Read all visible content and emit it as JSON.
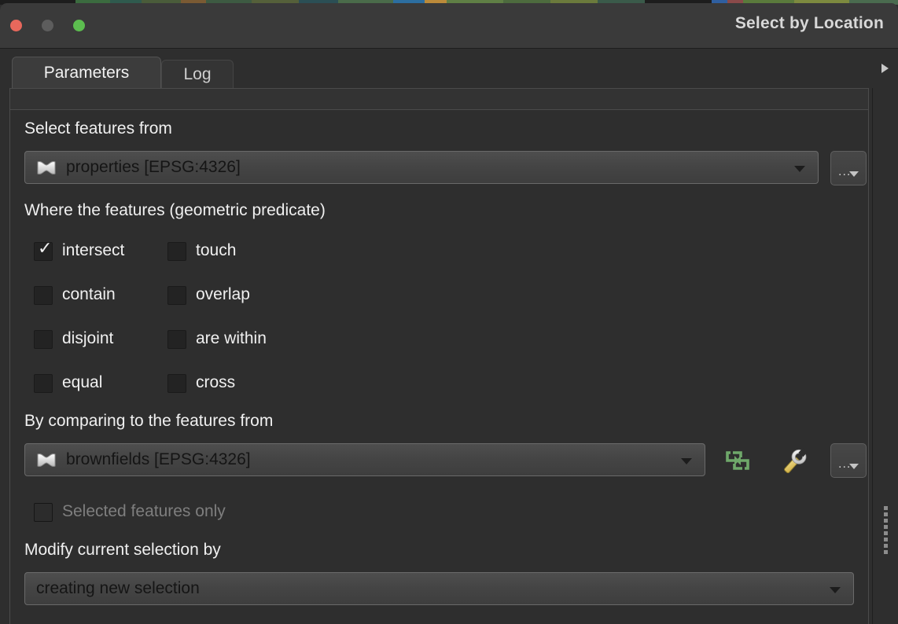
{
  "window": {
    "title": "Select by Location",
    "controls": {
      "close": "close-button",
      "minimize": "minimize-button",
      "maximize": "maximize-button"
    }
  },
  "tabs": [
    {
      "label": "Parameters",
      "active": true
    },
    {
      "label": "Log",
      "active": false
    }
  ],
  "expand_arrow_icon": "chevron-right-icon",
  "form": {
    "select_features_from": {
      "label": "Select features from",
      "value": "properties [EPSG:4326]",
      "layer_icon": "polygon-layer-icon",
      "dropdown_icon": "chevron-down-icon",
      "advanced_button": "..."
    },
    "predicate": {
      "label": "Where the features (geometric predicate)",
      "options": [
        {
          "label": "intersect",
          "checked": true
        },
        {
          "label": "touch",
          "checked": false
        },
        {
          "label": "contain",
          "checked": false
        },
        {
          "label": "overlap",
          "checked": false
        },
        {
          "label": "disjoint",
          "checked": false
        },
        {
          "label": "are within",
          "checked": false
        },
        {
          "label": "equal",
          "checked": false
        },
        {
          "label": "cross",
          "checked": false
        }
      ],
      "check_glyph": "✓"
    },
    "compare_to": {
      "label": "By comparing to the features from",
      "value": "brownfields [EPSG:4326]",
      "layer_icon": "polygon-layer-icon",
      "dropdown_icon": "chevron-down-icon",
      "iterate_icon": "iterate-loop-icon",
      "tool_icon": "wrench-icon",
      "advanced_button": "..."
    },
    "selected_features_only": {
      "label": "Selected features only",
      "checked": false,
      "disabled": true
    },
    "modify_selection": {
      "label": "Modify current selection by",
      "value": "creating new selection",
      "dropdown_icon": "chevron-down-icon"
    }
  },
  "colors": {
    "close": "#e8685c",
    "minimize": "#5d5d5d",
    "maximize": "#5cbd4f",
    "iterate_green": "#6fa86a",
    "wrench_handle": "#e8d27a",
    "window_bg": "#2e2e2e",
    "titlebar_bg": "#3a3a3a"
  },
  "splitter": {
    "grip_icon": "drag-handle-icon"
  }
}
